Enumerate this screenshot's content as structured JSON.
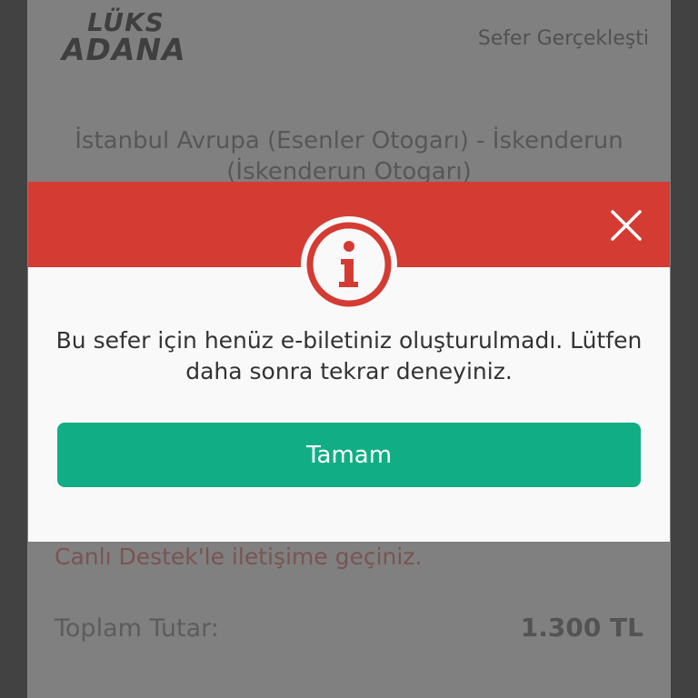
{
  "background": {
    "logo": {
      "line1": "LÜKS",
      "line2": "ADANA"
    },
    "status": "Sefer Gerçekleşti",
    "route": "İstanbul Avrupa (Esenler Otogarı) - İskenderun (İskenderun Otogarı)",
    "support_text": "Canlı Destek'le iletişime geçiniz.",
    "total_label": "Toplam Tutar:",
    "total_value": "1.300 TL"
  },
  "dialog": {
    "icon": "info-icon",
    "close_icon": "close-icon",
    "message": "Bu sefer için henüz e-biletiniz oluşturulmadı. Lütfen daha sonra tekrar deneyiniz.",
    "ok_label": "Tamam"
  },
  "colors": {
    "header_red": "#d43b33",
    "button_green": "#11ae85"
  }
}
